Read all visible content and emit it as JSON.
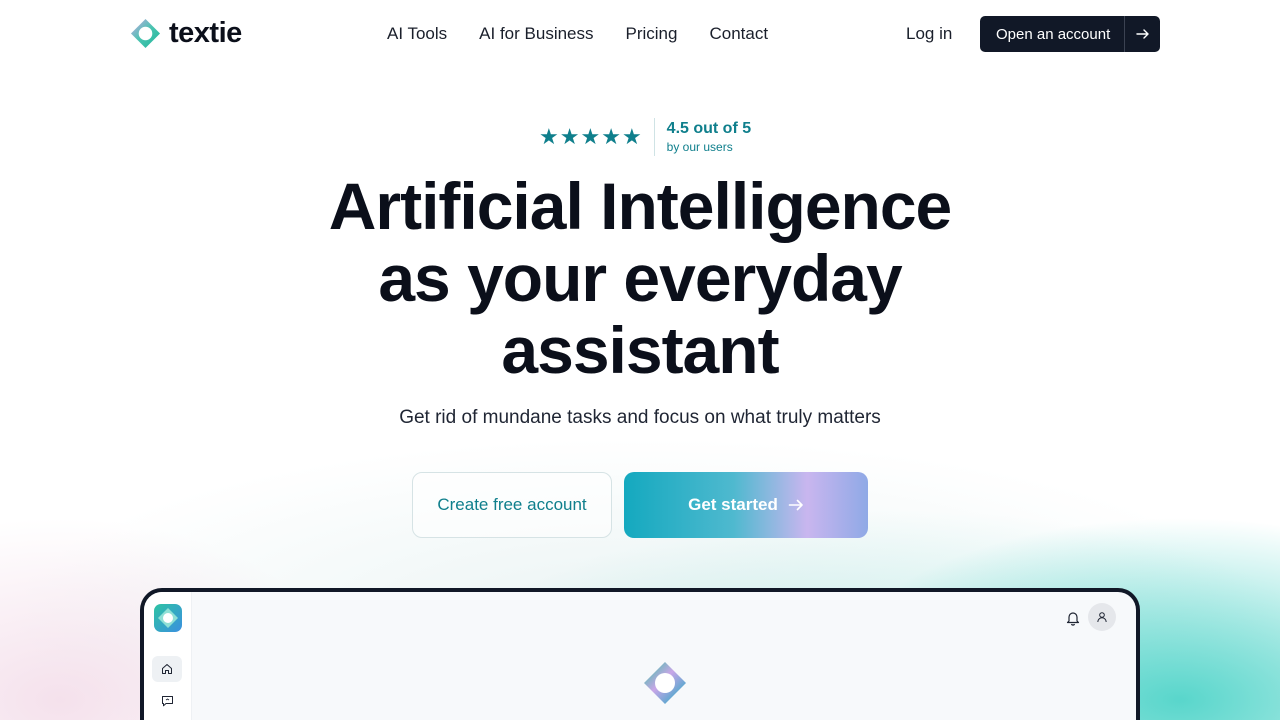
{
  "brand": {
    "name": "textie"
  },
  "nav": {
    "items": [
      {
        "label": "AI Tools"
      },
      {
        "label": "AI for Business"
      },
      {
        "label": "Pricing"
      },
      {
        "label": "Contact"
      }
    ],
    "login": "Log in",
    "cta": "Open an account"
  },
  "hero": {
    "rating": {
      "stars": 5,
      "value_label": "4.5 out of 5",
      "by_label": "by our users"
    },
    "headline_lines": [
      "Artificial Intelligence",
      "as your everyday",
      "assistant"
    ],
    "subtitle": "Get rid of mundane tasks and focus on what truly matters",
    "primary_cta": "Get started",
    "secondary_cta": "Create free account"
  },
  "preview": {
    "sidebar_icons": [
      "home-icon",
      "chat-icon"
    ],
    "header_icons": [
      "bell-icon",
      "user-icon"
    ]
  },
  "colors": {
    "accent": "#0f7f8c",
    "dark": "#111827",
    "gradient_start": "#14a9bf",
    "gradient_end": "#8fa9e6"
  }
}
